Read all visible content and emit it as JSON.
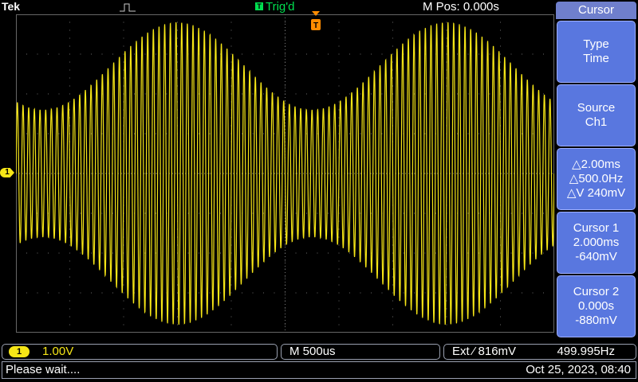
{
  "top": {
    "brand": "Tek",
    "trigger_state_badge": "T",
    "trigger_state": "Trig'd",
    "position": "M Pos: 0.000s"
  },
  "channel_marker": "1",
  "trigger_marker": "T",
  "menu": {
    "title": "Cursor",
    "buttons": [
      {
        "line1": "Type",
        "line2": "Time"
      },
      {
        "line1": "Source",
        "line2": "Ch1"
      },
      {
        "line1": "△2.00ms",
        "line2": "△500.0Hz",
        "line3": "△V 240mV"
      },
      {
        "line1": "Cursor 1",
        "line2": "2.000ms",
        "line3": "-640mV"
      },
      {
        "line1": "Cursor 2",
        "line2": "0.000s",
        "line3": "-880mV"
      }
    ]
  },
  "bottom": {
    "ch1_badge": "1",
    "ch1_scale": "1.00V",
    "timebase": "M 500us",
    "trigger": "Ext ⁄ 816mV",
    "frequency": "499.995Hz"
  },
  "status": {
    "message": "Please wait....",
    "datetime": "Oct 25, 2023, 08:40"
  },
  "colors": {
    "trace": "#f6e617",
    "menu_button": "#5977df",
    "menu_title": "#6f7fcc",
    "trig_text": "#00e050",
    "trigger_marker": "#ff8c00"
  },
  "waveform": {
    "type": "amplitude-modulated sine",
    "carrier_cycles_on_screen": 95,
    "envelope_cycles_on_screen": 2,
    "max_amplitude_divisions": 3.8,
    "min_amplitude_divisions": 1.6
  }
}
